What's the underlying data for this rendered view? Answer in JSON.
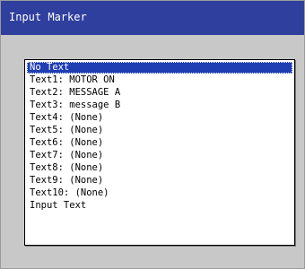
{
  "window": {
    "title": "Input Marker"
  },
  "list": {
    "selected_index": 0,
    "items": [
      "No Text",
      "Text1: MOTOR ON",
      "Text2: MESSAGE A",
      "Text3: message B",
      "Text4: (None)",
      "Text5: (None)",
      "Text6: (None)",
      "Text7: (None)",
      "Text8: (None)",
      "Text9: (None)",
      "Text10: (None)",
      "Input Text"
    ]
  },
  "colors": {
    "title_bar": "#2f3f9e",
    "selection": "#1f3eb3",
    "window_background": "#c8c8c8"
  }
}
